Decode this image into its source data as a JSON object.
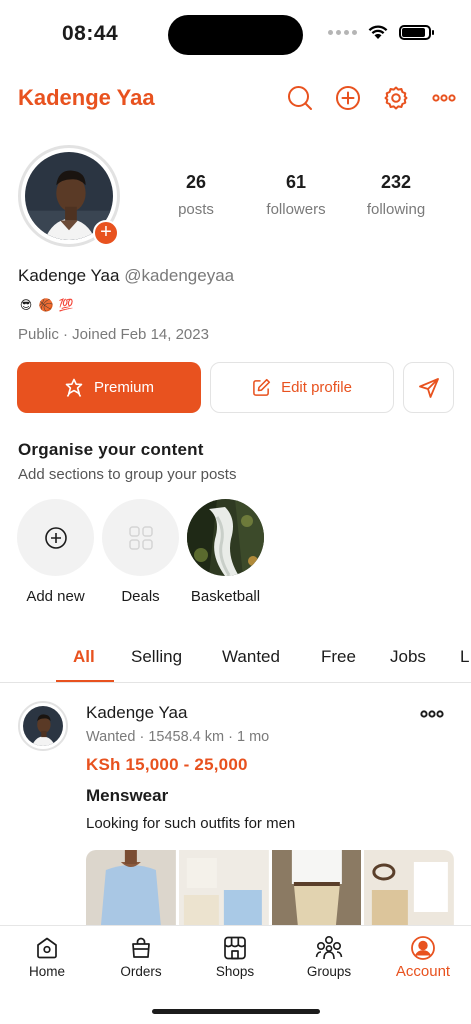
{
  "status_bar": {
    "time": "08:44"
  },
  "header": {
    "title": "Kadenge Yaa",
    "icons": [
      "search-icon",
      "add-circle-icon",
      "gear-icon",
      "more-icon"
    ]
  },
  "profile": {
    "stats": [
      {
        "value": "26",
        "label": "posts"
      },
      {
        "value": "61",
        "label": "followers"
      },
      {
        "value": "232",
        "label": "following"
      }
    ],
    "name": "Kadenge Yaa",
    "handle": "@kadengeyaa",
    "emojis": [
      "😎",
      "🏀",
      "💯"
    ],
    "joined": "Public · Joined Feb 14, 2023"
  },
  "actions": {
    "premium_label": "Premium",
    "edit_label": "Edit profile"
  },
  "organise": {
    "title": "Organise your content",
    "subtitle": "Add sections to group your posts",
    "sections": [
      {
        "label": "Add new"
      },
      {
        "label": "Deals"
      },
      {
        "label": "Basketball"
      }
    ]
  },
  "tabs": [
    "All",
    "Selling",
    "Wanted",
    "Free",
    "Jobs",
    "L"
  ],
  "active_tab": "All",
  "post": {
    "user": "Kadenge Yaa",
    "meta": "Wanted · 15458.4 km · 1 mo",
    "price": "KSh 15,000 - 25,000",
    "title": "Menswear",
    "description": "Looking for such outfits for men"
  },
  "bottom_nav": [
    {
      "label": "Home",
      "icon": "home-icon"
    },
    {
      "label": "Orders",
      "icon": "bag-icon"
    },
    {
      "label": "Shops",
      "icon": "shop-icon"
    },
    {
      "label": "Groups",
      "icon": "groups-icon"
    },
    {
      "label": "Account",
      "icon": "account-icon",
      "active": true
    }
  ],
  "colors": {
    "accent": "#e8521f",
    "muted": "#7a7a7a"
  }
}
